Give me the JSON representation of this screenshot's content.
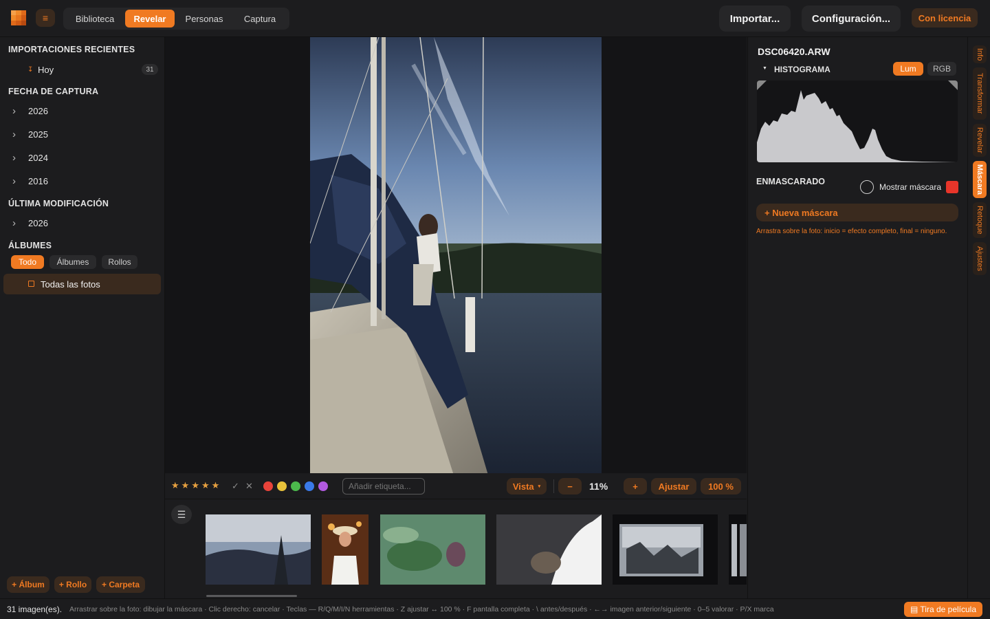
{
  "topbar": {
    "tabs": [
      {
        "label": "Biblioteca",
        "active": false
      },
      {
        "label": "Revelar",
        "active": true
      },
      {
        "label": "Personas",
        "active": false
      },
      {
        "label": "Captura",
        "active": false
      }
    ],
    "import_label": "Importar...",
    "settings_label": "Configuración...",
    "license_label": "Con licencia",
    "menu_icon": "hamburger-icon"
  },
  "sidebar": {
    "recent_heading": "IMPORTACIONES RECIENTES",
    "recent_items": [
      {
        "label": "Hoy",
        "count": "31"
      }
    ],
    "capture_heading": "FECHA DE CAPTURA",
    "capture_years": [
      "2026",
      "2025",
      "2024",
      "2016"
    ],
    "modified_heading": "ÚLTIMA MODIFICACIÓN",
    "modified_years": [
      "2026"
    ],
    "albums_heading": "ÁLBUMES",
    "album_filters": [
      {
        "label": "Todo",
        "active": true
      },
      {
        "label": "Álbumes",
        "active": false
      },
      {
        "label": "Rollos",
        "active": false
      }
    ],
    "all_photos": "Todas las fotos",
    "buttons": {
      "album": "+ Álbum",
      "roll": "+ Rollo",
      "folder": "+ Carpeta"
    }
  },
  "toolbar": {
    "rating_stars": 5,
    "tag_placeholder": "Añadir etiqueta...",
    "view_label": "Vista",
    "view_arrow": "▾",
    "zoom_out": "−",
    "zoom_value": "11%",
    "zoom_in": "+",
    "fit_label": "Ajustar",
    "full_label": "100 %",
    "color_labels": [
      "#e8433a",
      "#e8c23a",
      "#4cb84c",
      "#3a7ae8",
      "#b25ae0"
    ]
  },
  "right_panel": {
    "filename": "DSC06420.ARW",
    "histogram_heading": "HISTOGRAMA",
    "lum_label": "Lum",
    "rgb_label": "RGB",
    "masking_heading": "ENMASCARADO",
    "show_mask_label": "Mostrar máscara",
    "mask_color": "#e8352a",
    "new_mask_label": "+ Nueva máscara",
    "hint": "Arrastra sobre la foto: inicio = efecto completo, final = ninguno."
  },
  "side_tabs": [
    {
      "label": "Info",
      "active": false
    },
    {
      "label": "Transformar",
      "active": false
    },
    {
      "label": "Revelar",
      "active": false
    },
    {
      "label": "Máscara",
      "active": true
    },
    {
      "label": "Retoque",
      "active": false
    },
    {
      "label": "Ajustes",
      "active": false
    }
  ],
  "status": {
    "count": "31 imagen(es).",
    "hint": "Arrastrar sobre la foto: dibujar la máscara · Clic derecho: cancelar   ·   Teclas — R/Q/M/I/N herramientas · Z ajustar ↔ 100 % · F pantalla completa · \\ antes/después · ←→ imagen anterior/siguiente · 0–5 valorar · P/X marca",
    "filmstrip_label": "▤ Tira de película"
  },
  "colors": {
    "accent": "#f07a22",
    "accent_dark": "#3a2a1e",
    "background": "#1c1c1e"
  }
}
